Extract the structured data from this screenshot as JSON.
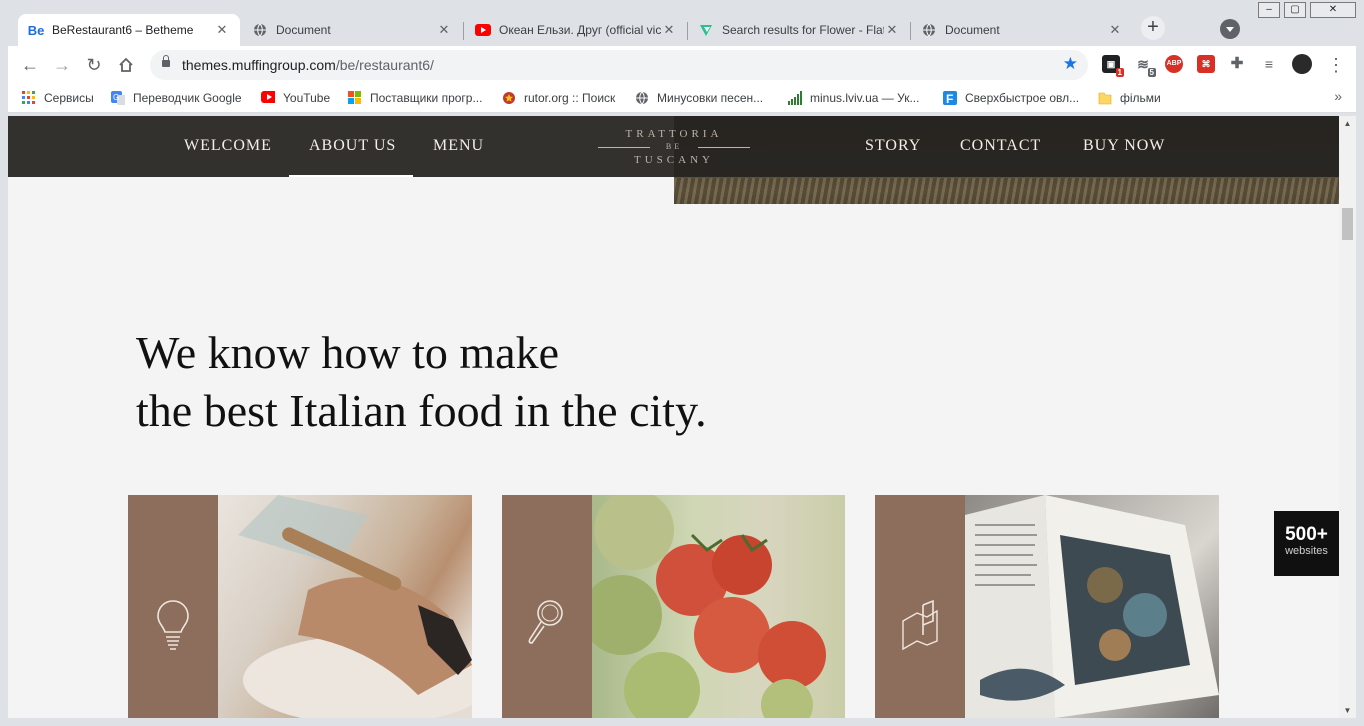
{
  "browser": {
    "tabs": [
      {
        "title": "BeRestaurant6 – Betheme",
        "favicon": "be-logo-icon",
        "active": true
      },
      {
        "title": "Document",
        "favicon": "globe-icon",
        "active": false
      },
      {
        "title": "Океан Ельзи. Друг (official vic",
        "favicon": "youtube-icon",
        "active": false
      },
      {
        "title": "Search results for Flower - Flat",
        "favicon": "flaticon-icon",
        "active": false
      },
      {
        "title": "Document",
        "favicon": "globe-icon",
        "active": false
      }
    ],
    "url_host": "themes.muffingroup.com",
    "url_path": "/be/restaurant6/",
    "extensions": [
      {
        "name": "notification-extension-icon",
        "badge": "1"
      },
      {
        "name": "reader-extension-icon",
        "badge": "5"
      },
      {
        "name": "adblock-extension-icon",
        "label": "ABP"
      },
      {
        "name": "pdf-extension-icon"
      },
      {
        "name": "puzzle-extensions-icon"
      },
      {
        "name": "reading-list-icon"
      }
    ],
    "bookmarks": [
      {
        "label": "Сервисы",
        "icon": "apps-grid-icon"
      },
      {
        "label": "Переводчик Google",
        "icon": "google-translate-icon"
      },
      {
        "label": "YouTube",
        "icon": "youtube-icon"
      },
      {
        "label": "Поставщики прогр...",
        "icon": "microsoft-icon"
      },
      {
        "label": "rutor.org :: Поиск",
        "icon": "rutor-icon"
      },
      {
        "label": "Минусовки песен...",
        "icon": "globe-icon"
      },
      {
        "label": "minus.lviv.ua — Ук...",
        "icon": "signal-bars-icon"
      },
      {
        "label": "Сверхбыстрое овл...",
        "icon": "f-logo-icon"
      },
      {
        "label": "фільми",
        "icon": "folder-icon"
      }
    ],
    "colors": {
      "accent": "#1a73e8",
      "frame": "#dee1e6"
    }
  },
  "site": {
    "nav": {
      "left": [
        "WELCOME",
        "ABOUT US",
        "MENU"
      ],
      "right": [
        "STORY",
        "CONTACT",
        "BUY NOW"
      ],
      "active": "ABOUT US"
    },
    "logo": {
      "line1": "TRATTORIA",
      "line2": "BE",
      "line3": "TUSCANY"
    },
    "headline": {
      "line1": "We know how to make",
      "line2": "the best Italian food in the city."
    },
    "cards": [
      {
        "icon": "lightbulb-icon",
        "photo": "hands-kneading-dough-photo"
      },
      {
        "icon": "magnifier-icon",
        "photo": "tomatoes-vine-photo"
      },
      {
        "icon": "flag-map-icon",
        "photo": "open-recipe-book-photo"
      }
    ],
    "badge": {
      "number": "500+",
      "label": "websites"
    },
    "colors": {
      "card_side": "#8d6e5d",
      "nav_bg": "#262421",
      "page_bg": "#f4f4f4"
    }
  }
}
